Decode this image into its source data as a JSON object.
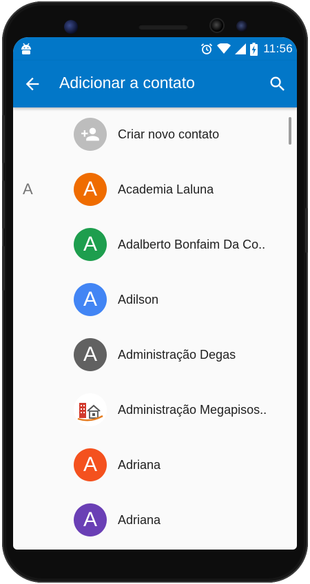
{
  "status_bar": {
    "time": "11:56",
    "icons": [
      "android-icon",
      "alarm-icon",
      "wifi-icon",
      "signal-icon",
      "battery-charging-icon"
    ]
  },
  "app_bar": {
    "title": "Adicionar a contato",
    "back_icon": "arrow-back-icon",
    "search_icon": "search-icon",
    "color": "#0277c8"
  },
  "contacts": [
    {
      "section": "",
      "name": "Criar novo contato",
      "avatar_letter": "",
      "avatar_color": "#bdbdbd",
      "avatar_icon": "add-person-icon"
    },
    {
      "section": "A",
      "name": "Academia Laluna",
      "avatar_letter": "A",
      "avatar_color": "#ef6c00"
    },
    {
      "section": "",
      "name": "Adalberto Bonfaim Da Co..",
      "avatar_letter": "A",
      "avatar_color": "#1e9e4e"
    },
    {
      "section": "",
      "name": "Adilson",
      "avatar_letter": "A",
      "avatar_color": "#4285f4"
    },
    {
      "section": "",
      "name": "Administração Degas",
      "avatar_letter": "A",
      "avatar_color": "#616161"
    },
    {
      "section": "",
      "name": "Administração Megapisos..",
      "avatar_letter": "",
      "avatar_color": "#ffffff",
      "avatar_icon": "building-logo-icon"
    },
    {
      "section": "",
      "name": "Adriana",
      "avatar_letter": "A",
      "avatar_color": "#f4511e"
    },
    {
      "section": "",
      "name": "Adriana",
      "avatar_letter": "A",
      "avatar_color": "#6a3fb5"
    }
  ]
}
